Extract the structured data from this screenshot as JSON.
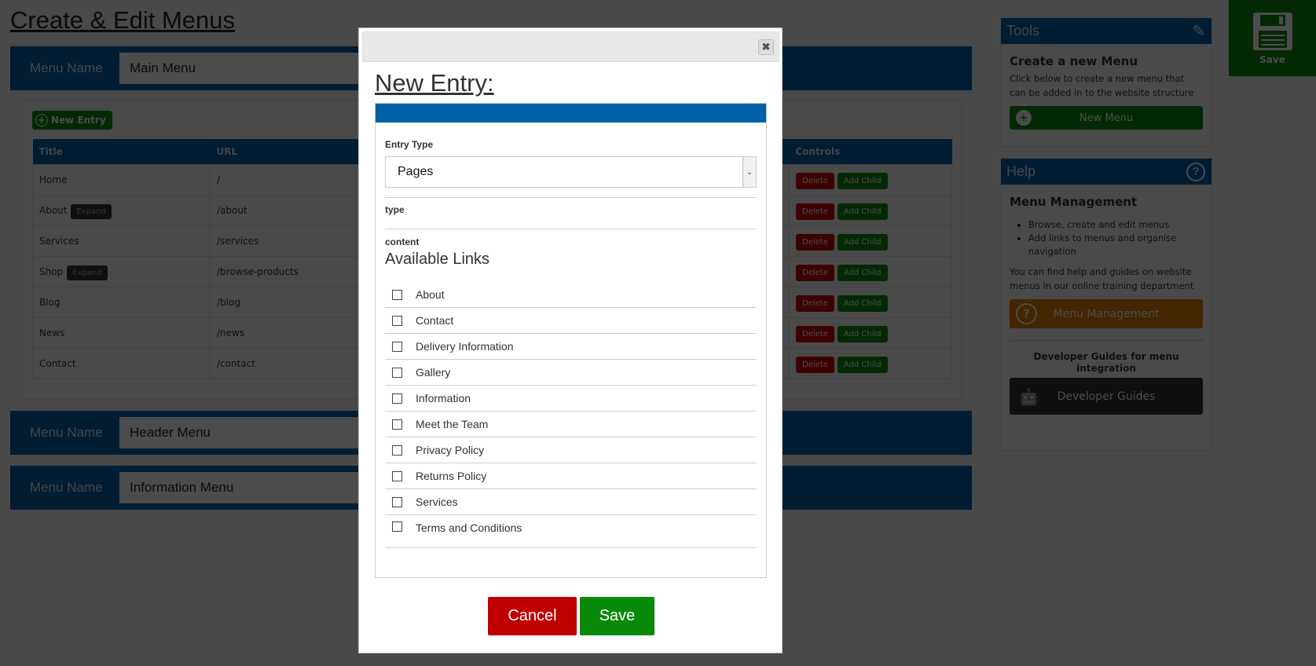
{
  "page": {
    "title": "Create & Edit Menus"
  },
  "menus": [
    {
      "label": "Menu Name",
      "value": "Main Menu"
    },
    {
      "label": "Menu Name",
      "value": "Header Menu"
    },
    {
      "label": "Menu Name",
      "value": "Information Menu"
    }
  ],
  "main_menu": {
    "new_entry_label": "New Entry",
    "columns": [
      "Title",
      "URL",
      "Controls"
    ],
    "expand_label": "Expand",
    "delete_label": "Delete",
    "add_child_label": "Add Child",
    "rows": [
      {
        "title": "Home",
        "url": "/",
        "expand": false
      },
      {
        "title": "About",
        "url": "/about",
        "expand": true
      },
      {
        "title": "Services",
        "url": "/services",
        "expand": false
      },
      {
        "title": "Shop",
        "url": "/browse-products",
        "expand": true
      },
      {
        "title": "Blog",
        "url": "/blog",
        "expand": false
      },
      {
        "title": "News",
        "url": "/news",
        "expand": false
      },
      {
        "title": "Contact",
        "url": "/contact",
        "expand": false
      }
    ]
  },
  "tools": {
    "header": "Tools",
    "heading": "Create a new Menu",
    "text": "Click below to create a new menu that can be added in to the website structure",
    "button": "New Menu"
  },
  "help": {
    "header": "Help",
    "heading": "Menu Management",
    "bullets": [
      "Browse, create and edit menus",
      "Add links to menus and organise navigation"
    ],
    "text": "You can find help and guides on website menus in our online training department",
    "button": "Menu Management",
    "dev_heading": "Developer Guides for menu integration",
    "dev_button": "Developer Guides"
  },
  "save_box": {
    "label": "Save"
  },
  "modal": {
    "title": "New Entry:",
    "entry_type_label": "Entry Type",
    "entry_type_value": "Pages",
    "type_label": "type",
    "content_label": "content",
    "links_heading": "Available Links",
    "links": [
      "About",
      "Contact",
      "Delivery Information",
      "Gallery",
      "Information",
      "Meet the Team",
      "Privacy Policy",
      "Returns Policy",
      "Services",
      "Terms and Conditions"
    ],
    "cancel": "Cancel",
    "save": "Save"
  },
  "colors": {
    "brand_blue": "#0060ad",
    "green": "#0a8a0a",
    "red": "#c00000",
    "orange": "#e07b00",
    "dark": "#333333"
  }
}
